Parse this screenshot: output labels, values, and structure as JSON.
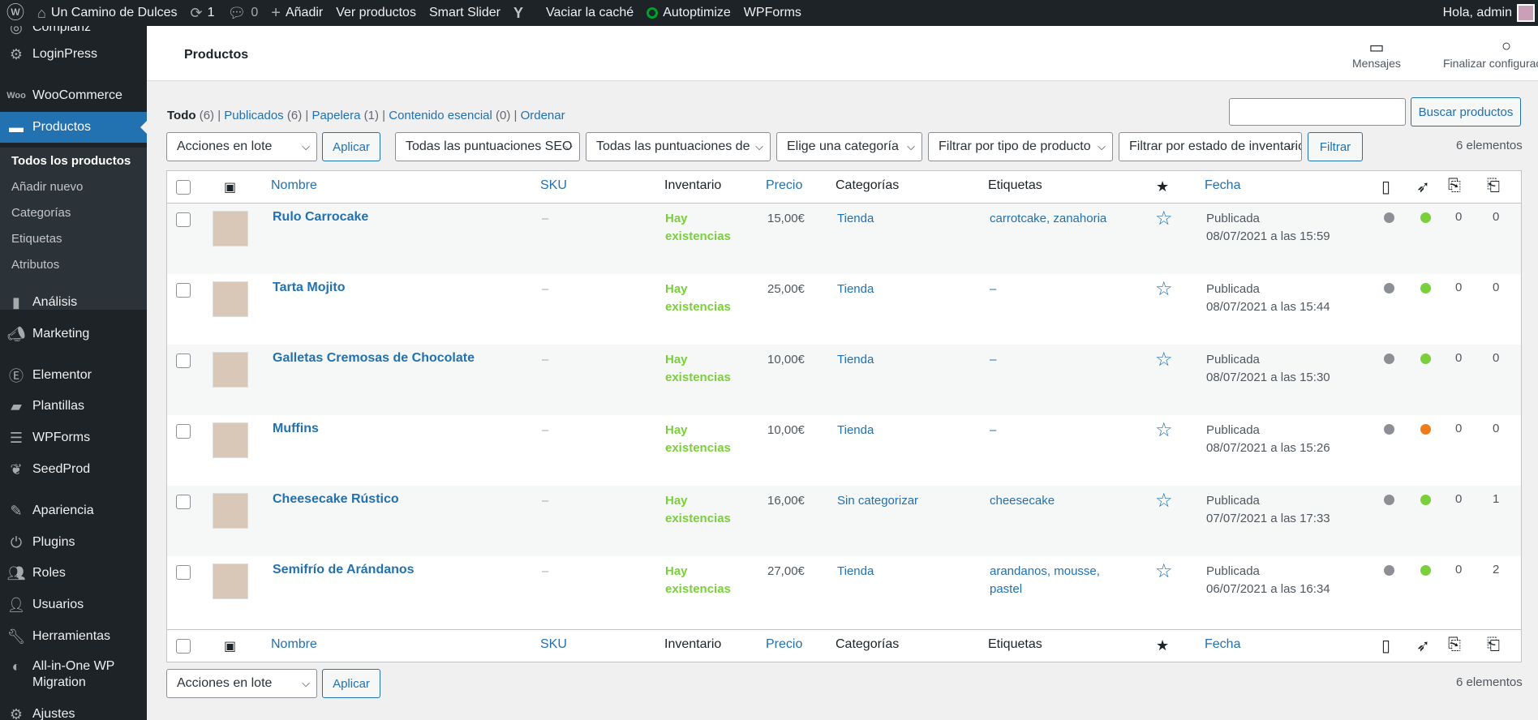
{
  "adminbar": {
    "site_name": "Un Camino de Dulces",
    "updates_count": "1",
    "comments_count": "0",
    "new_label": "Añadir",
    "view_products": "Ver productos",
    "smart_slider": "Smart Slider",
    "clear_cache": "Vaciar la caché",
    "autoptimize": "Autoptimize",
    "wpforms": "WPForms",
    "greeting": "Hola, admin"
  },
  "sidebar": {
    "items": [
      {
        "label": "Compianz",
        "icon": "compliance-icon"
      },
      {
        "label": "LoginPress",
        "icon": "loginpress-icon"
      },
      {
        "label": "WooCommerce",
        "icon": "woocommerce-icon"
      },
      {
        "label": "Productos",
        "icon": "products-icon"
      },
      {
        "label": "Análisis",
        "icon": "analytics-icon"
      },
      {
        "label": "Marketing",
        "icon": "marketing-icon"
      },
      {
        "label": "Elementor",
        "icon": "elementor-icon"
      },
      {
        "label": "Plantillas",
        "icon": "templates-icon"
      },
      {
        "label": "WPForms",
        "icon": "wpforms-icon"
      },
      {
        "label": "SeedProd",
        "icon": "seedprod-icon"
      },
      {
        "label": "Apariencia",
        "icon": "appearance-icon"
      },
      {
        "label": "Plugins",
        "icon": "plugins-icon"
      },
      {
        "label": "Roles",
        "icon": "roles-icon"
      },
      {
        "label": "Usuarios",
        "icon": "users-icon"
      },
      {
        "label": "Herramientas",
        "icon": "tools-icon"
      },
      {
        "label": "All-in-One WP",
        "label2": "Migration",
        "icon": "migration-icon"
      },
      {
        "label": "Ajustes",
        "icon": "settings-icon"
      }
    ],
    "submenu": [
      "Todos los productos",
      "Añadir nuevo",
      "Categorías",
      "Etiquetas",
      "Atributos"
    ]
  },
  "header": {
    "title": "Productos",
    "messages": "Mensajes",
    "finish_setup": "Finalizar configuración"
  },
  "views": {
    "all": "Todo",
    "all_count": "(6)",
    "published": "Publicados",
    "published_count": "(6)",
    "trash": "Papelera",
    "trash_count": "(1)",
    "essential": "Contenido esencial",
    "essential_count": "(0)",
    "sort": "Ordenar"
  },
  "search": {
    "button": "Buscar productos",
    "value": ""
  },
  "filters": {
    "bulk_actions": "Acciones en lote",
    "apply": "Aplicar",
    "seo_scores": "Todas las puntuaciones SEO",
    "readability_scores": "Todas las puntuaciones de",
    "category": "Elige una categoría",
    "product_type": "Filtrar por tipo de producto",
    "stock_status": "Filtrar por estado de inventario",
    "filter_button": "Filtrar",
    "items_count": "6 elementos"
  },
  "columns": {
    "name": "Nombre",
    "sku": "SKU",
    "stock": "Inventario",
    "price": "Precio",
    "categories": "Categorías",
    "tags": "Etiquetas",
    "date": "Fecha"
  },
  "products": [
    {
      "name": "Rulo Carrocake",
      "sku": "–",
      "stock1": "Hay",
      "stock2": "existencias",
      "price": "15,00€",
      "category": "Tienda",
      "tags": "carrotcake, zanahoria",
      "tags2": "",
      "status": "Publicada",
      "date": "08/07/2021 a las 15:59",
      "seo": "#8c8f94",
      "read": "#7ad03a",
      "links": "0",
      "inlinks": "0"
    },
    {
      "name": "Tarta Mojito",
      "sku": "–",
      "stock1": "Hay",
      "stock2": "existencias",
      "price": "25,00€",
      "category": "Tienda",
      "tags": "–",
      "tags2": "",
      "status": "Publicada",
      "date": "08/07/2021 a las 15:44",
      "seo": "#8c8f94",
      "read": "#7ad03a",
      "links": "0",
      "inlinks": "0"
    },
    {
      "name": "Galletas Cremosas de Chocolate",
      "sku": "–",
      "stock1": "Hay",
      "stock2": "existencias",
      "price": "10,00€",
      "category": "Tienda",
      "tags": "–",
      "tags2": "",
      "status": "Publicada",
      "date": "08/07/2021 a las 15:30",
      "seo": "#8c8f94",
      "read": "#7ad03a",
      "links": "0",
      "inlinks": "0"
    },
    {
      "name": "Muffins",
      "sku": "–",
      "stock1": "Hay",
      "stock2": "existencias",
      "price": "10,00€",
      "category": "Tienda",
      "tags": "–",
      "tags2": "",
      "status": "Publicada",
      "date": "08/07/2021 a las 15:26",
      "seo": "#8c8f94",
      "read": "#ee7c1b",
      "links": "0",
      "inlinks": "0"
    },
    {
      "name": "Cheesecake Rústico",
      "sku": "–",
      "stock1": "Hay",
      "stock2": "existencias",
      "price": "16,00€",
      "category": "Sin categorizar",
      "tags": "cheesecake",
      "tags2": "",
      "status": "Publicada",
      "date": "07/07/2021 a las 17:33",
      "seo": "#8c8f94",
      "read": "#7ad03a",
      "links": "0",
      "inlinks": "1"
    },
    {
      "name": "Semifrío de Arándanos",
      "sku": "–",
      "stock1": "Hay",
      "stock2": "existencias",
      "price": "27,00€",
      "category": "Tienda",
      "tags": "arandanos, mousse,",
      "tags2": "pastel",
      "status": "Publicada",
      "date": "06/07/2021 a las 16:34",
      "seo": "#8c8f94",
      "read": "#7ad03a",
      "links": "0",
      "inlinks": "2"
    }
  ],
  "colors": {
    "accent": "#2271b1",
    "sidebar": "#1d2327",
    "in_stock": "#7ad03a"
  }
}
